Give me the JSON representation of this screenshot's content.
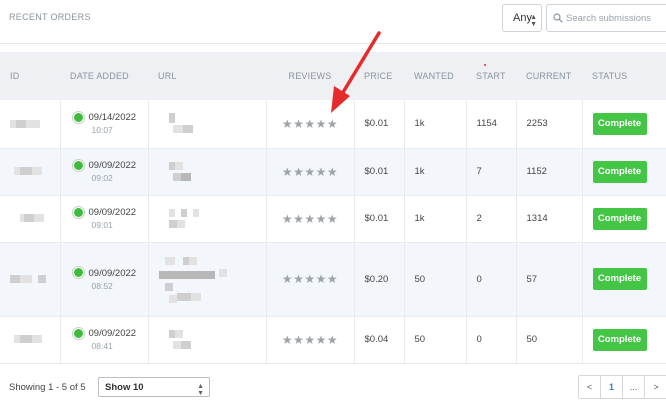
{
  "header": {
    "title": "RECENT ORDERS",
    "filter_value": "Any",
    "search_placeholder": "Search submissions"
  },
  "table": {
    "columns": [
      "ID",
      "DATE ADDED",
      "URL",
      "REVIEWS",
      "PRICE",
      "WANTED",
      "START",
      "CURRENT",
      "STATUS"
    ],
    "rows": [
      {
        "date": "09/14/2022",
        "time": "10:07",
        "price": "$0.01",
        "wanted": "1k",
        "start": "1154",
        "current": "2253",
        "status": "Complete",
        "stars": "★★★★★"
      },
      {
        "date": "09/09/2022",
        "time": "09:02",
        "price": "$0.01",
        "wanted": "1k",
        "start": "7",
        "current": "1152",
        "status": "Complete",
        "stars": "★★★★★"
      },
      {
        "date": "09/09/2022",
        "time": "09:01",
        "price": "$0.01",
        "wanted": "1k",
        "start": "2",
        "current": "1314",
        "status": "Complete",
        "stars": "★★★★★"
      },
      {
        "date": "09/09/2022",
        "time": "08:52",
        "price": "$0.20",
        "wanted": "50",
        "start": "0",
        "current": "57",
        "status": "Complete",
        "stars": "★★★★★"
      },
      {
        "date": "09/09/2022",
        "time": "08:41",
        "price": "$0.04",
        "wanted": "50",
        "start": "0",
        "current": "50",
        "status": "Complete",
        "stars": "★★★★★"
      }
    ]
  },
  "footer": {
    "showing_text": "Showing 1 - 5 of 5",
    "page_size": "Show 10",
    "pagination": {
      "prev": "<",
      "current": "1",
      "ellipsis": "...",
      "next": ">"
    }
  },
  "icons": {
    "search": "search-icon",
    "status": "check-circle-icon",
    "arrow": "red-arrow-annotation"
  },
  "colors": {
    "complete": "#45c545",
    "status_dot": "#3dbb3d",
    "arrow": "#e52b2b",
    "accent": "#3a7bd5"
  }
}
